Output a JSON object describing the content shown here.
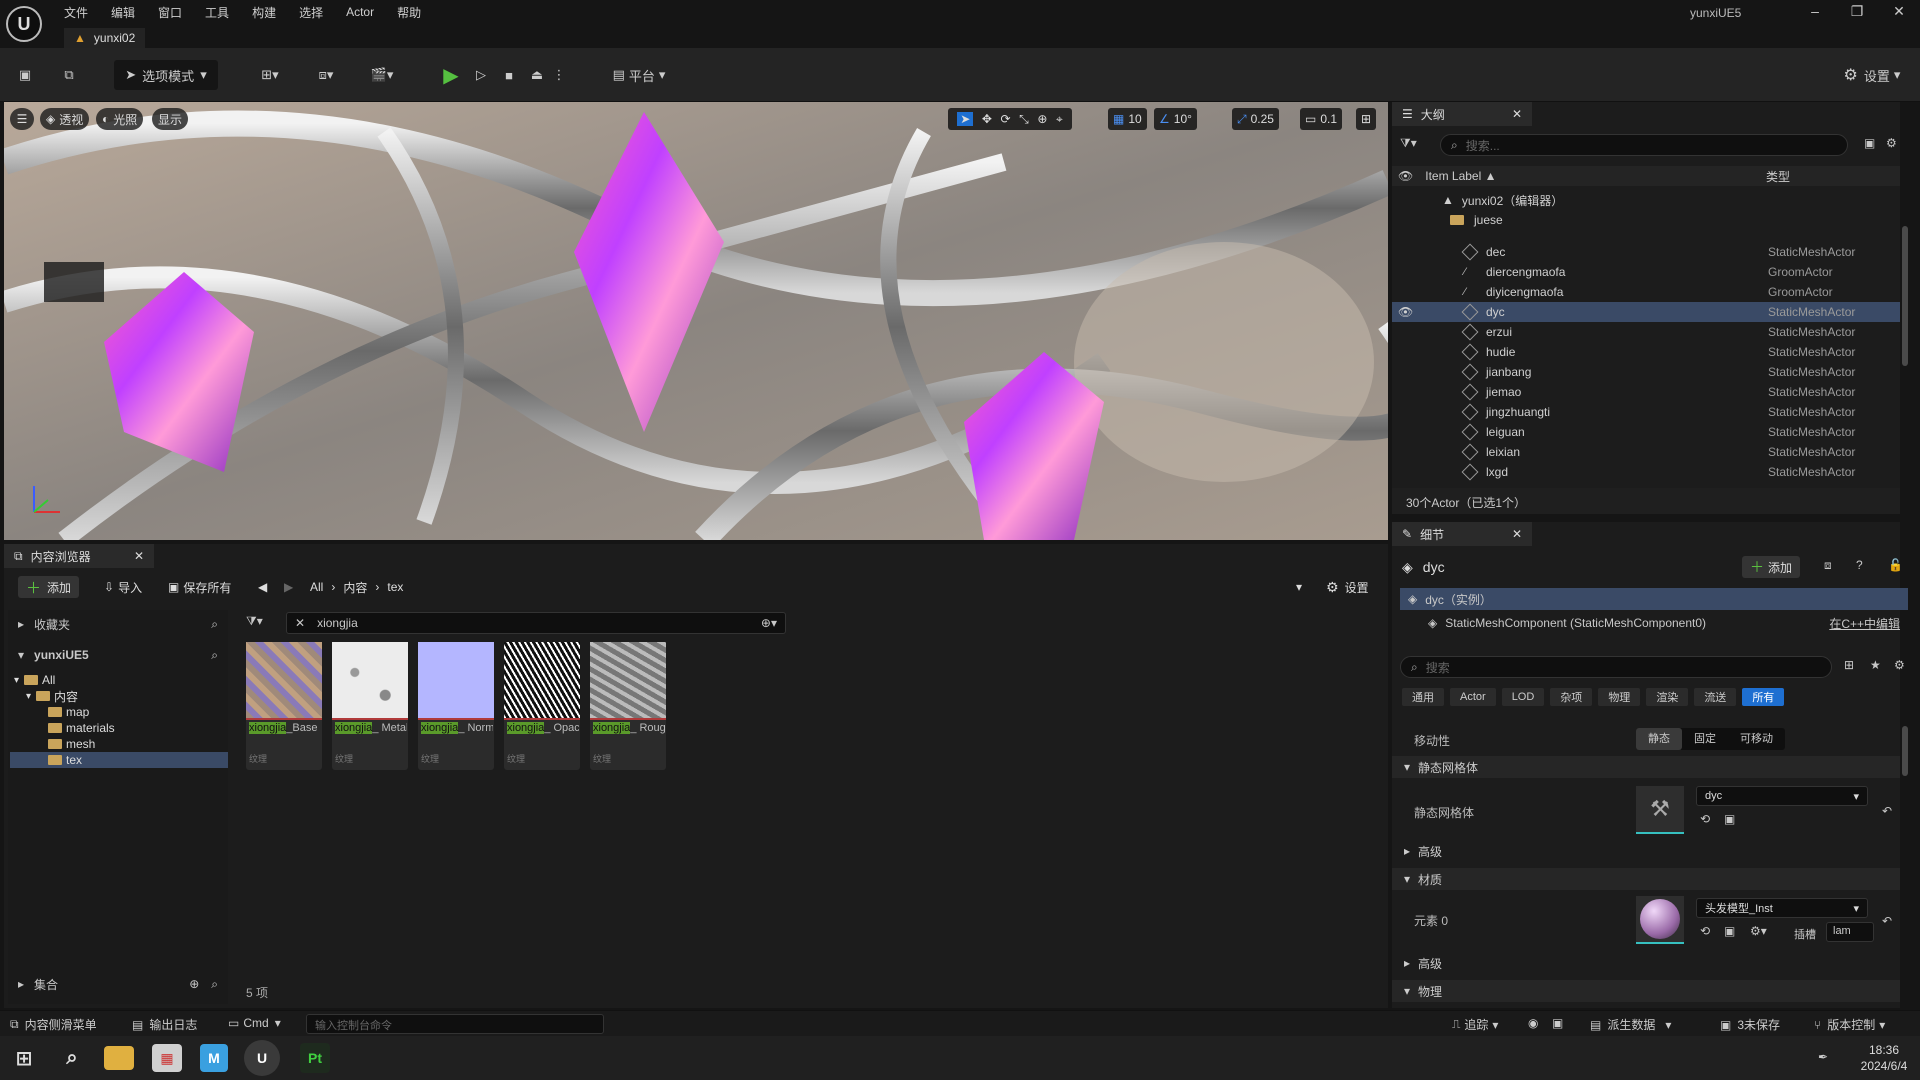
{
  "menu": [
    "文件",
    "编辑",
    "窗口",
    "工具",
    "构建",
    "选择",
    "Actor",
    "帮助"
  ],
  "document_tab": "yunxi02",
  "app_title": "yunxiUE5",
  "toolbar": {
    "mode_label": "选项模式",
    "platform_label": "平台",
    "settings_label": "设置"
  },
  "viewport": {
    "perspective": "透视",
    "lighting": "光照",
    "show": "显示",
    "grid_snap": "10",
    "rotate_snap": "10°",
    "scale_snap": "0.25",
    "camera_speed": "0.1"
  },
  "outliner": {
    "tab": "大纲",
    "search_placeholder": "搜索...",
    "col_label": "Item Label ▲",
    "col_type": "类型",
    "root": "yunxi02（编辑器）",
    "folder": "juese",
    "rows": [
      {
        "name": "dec",
        "type": "StaticMeshActor",
        "icon": "mesh"
      },
      {
        "name": "diercengmaofa",
        "type": "GroomActor",
        "icon": "groom"
      },
      {
        "name": "diyicengmaofa",
        "type": "GroomActor",
        "icon": "groom"
      },
      {
        "name": "dyc",
        "type": "StaticMeshActor",
        "icon": "mesh",
        "selected": true
      },
      {
        "name": "erzui",
        "type": "StaticMeshActor",
        "icon": "mesh"
      },
      {
        "name": "hudie",
        "type": "StaticMeshActor",
        "icon": "mesh"
      },
      {
        "name": "jianbang",
        "type": "StaticMeshActor",
        "icon": "mesh"
      },
      {
        "name": "jiemao",
        "type": "StaticMeshActor",
        "icon": "mesh"
      },
      {
        "name": "jingzhuangti",
        "type": "StaticMeshActor",
        "icon": "mesh"
      },
      {
        "name": "leiguan",
        "type": "StaticMeshActor",
        "icon": "mesh"
      },
      {
        "name": "leixian",
        "type": "StaticMeshActor",
        "icon": "mesh"
      },
      {
        "name": "lxgd",
        "type": "StaticMeshActor",
        "icon": "mesh"
      }
    ],
    "footer": "30个Actor（已选1个）"
  },
  "content_browser": {
    "tab": "内容浏览器",
    "add": "添加",
    "import": "导入",
    "save_all": "保存所有",
    "path": [
      "All",
      "内容",
      "tex"
    ],
    "settings": "设置",
    "favorites": "收藏夹",
    "project": "yunxiUE5",
    "tree": [
      {
        "label": "All",
        "depth": 0
      },
      {
        "label": "内容",
        "depth": 1
      },
      {
        "label": "map",
        "depth": 2
      },
      {
        "label": "materials",
        "depth": 2
      },
      {
        "label": "mesh",
        "depth": 2
      },
      {
        "label": "tex",
        "depth": 2,
        "selected": true
      }
    ],
    "collections": "集合",
    "filter_text": "xiongjia",
    "assets": [
      {
        "hl": "xiongjia",
        "name": "_Base Color",
        "kind": "纹理",
        "thumb": "#a08a7a"
      },
      {
        "hl": "xiongjia",
        "name": "_ Metalness",
        "kind": "纹理",
        "thumb": "#e8e8e8"
      },
      {
        "hl": "xiongjia",
        "name": "_ Normal",
        "kind": "纹理",
        "thumb": "#b4b6ff"
      },
      {
        "hl": "xiongjia",
        "name": "_ Opacity",
        "kind": "纹理",
        "thumb": "#404040"
      },
      {
        "hl": "xiongjia",
        "name": "_ Roughness",
        "kind": "纹理",
        "thumb": "#9a9a9a"
      }
    ],
    "item_count": "5 项"
  },
  "details": {
    "tab": "细节",
    "object": "dyc",
    "add": "添加",
    "instance": "dyc（实例）",
    "component": "StaticMeshComponent (StaticMeshComponent0)",
    "edit_cpp": "在C++中编辑",
    "search_placeholder": "搜索",
    "filters": [
      "通用",
      "Actor",
      "LOD",
      "杂项",
      "物理",
      "渲染",
      "流送",
      "所有"
    ],
    "active_filter": "所有",
    "mobility_label": "移动性",
    "mobility_options": [
      "静态",
      "固定",
      "可移动"
    ],
    "mobility_selected": "静态",
    "static_mesh_section": "静态网格体",
    "static_mesh_label": "静态网格体",
    "static_mesh_value": "dyc",
    "advanced": "高级",
    "materials_section": "材质",
    "element0_label": "元素 0",
    "material_value": "头发模型_Inst",
    "slot_label": "插槽",
    "slot_value": "lam",
    "advanced2": "高级",
    "physics_section": "物理"
  },
  "statusbar": {
    "content_drawer": "内容侧滑菜单",
    "output_log": "输出日志",
    "cmd": "Cmd",
    "console_placeholder": "输入控制台命令",
    "trace": "追踪",
    "derived_data": "派生数据",
    "unsaved": "3未保存",
    "source_control": "版本控制"
  },
  "taskbar": {
    "time": "18:36",
    "date": "2024/6/4"
  },
  "colors": {
    "accent": "#1e6fd1",
    "play": "#55c040",
    "highlight": "#5a9a2a"
  }
}
